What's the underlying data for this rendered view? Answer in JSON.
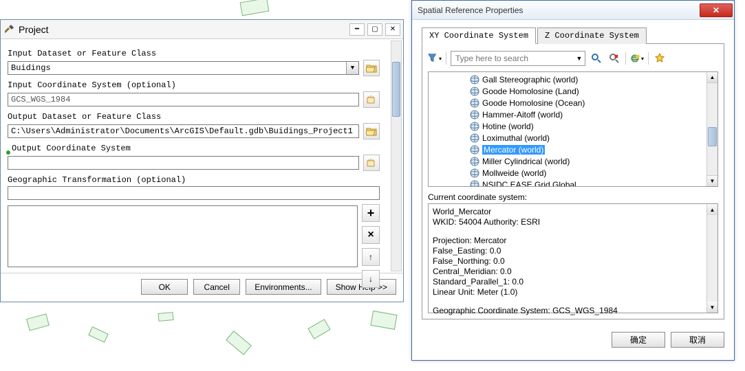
{
  "project": {
    "title": "Project",
    "labels": {
      "input_ds": "Input Dataset or Feature Class",
      "input_cs": "Input Coordinate System (optional)",
      "output_ds": "Output Dataset or Feature Class",
      "output_cs": "Output Coordinate System",
      "geo_trans": "Geographic Transformation (optional)"
    },
    "values": {
      "input_ds": "Buidings",
      "input_cs": "GCS_WGS_1984",
      "output_ds": "C:\\Users\\Administrator\\Documents\\ArcGIS\\Default.gdb\\Buidings_Project1",
      "output_cs": ""
    },
    "buttons": {
      "ok": "OK",
      "cancel": "Cancel",
      "env": "Environments...",
      "help": "Show Help >>"
    }
  },
  "srp": {
    "title": "Spatial Reference Properties",
    "tabs": {
      "xy": "XY Coordinate System",
      "z": "Z Coordinate System"
    },
    "search_placeholder": "Type here to search",
    "list": [
      "Gall Stereographic (world)",
      "Goode Homolosine (Land)",
      "Goode Homolosine (Ocean)",
      "Hammer-Aitoff (world)",
      "Hotine (world)",
      "Loximuthal (world)",
      "Mercator (world)",
      "Miller Cylindrical (world)",
      "Mollweide (world)",
      "NSIDC EASE Grid Global"
    ],
    "selected_index": 6,
    "ccs_label": "Current coordinate system:",
    "ccs": {
      "l1": "World_Mercator",
      "l2": "WKID: 54004 Authority: ESRI",
      "l3": "Projection: Mercator",
      "l4": "False_Easting: 0.0",
      "l5": "False_Northing: 0.0",
      "l6": "Central_Meridian: 0.0",
      "l7": "Standard_Parallel_1: 0.0",
      "l8": "Linear Unit: Meter (1.0)",
      "l9": "Geographic Coordinate System: GCS_WGS_1984"
    },
    "buttons": {
      "ok": "确定",
      "cancel": "取消"
    }
  }
}
